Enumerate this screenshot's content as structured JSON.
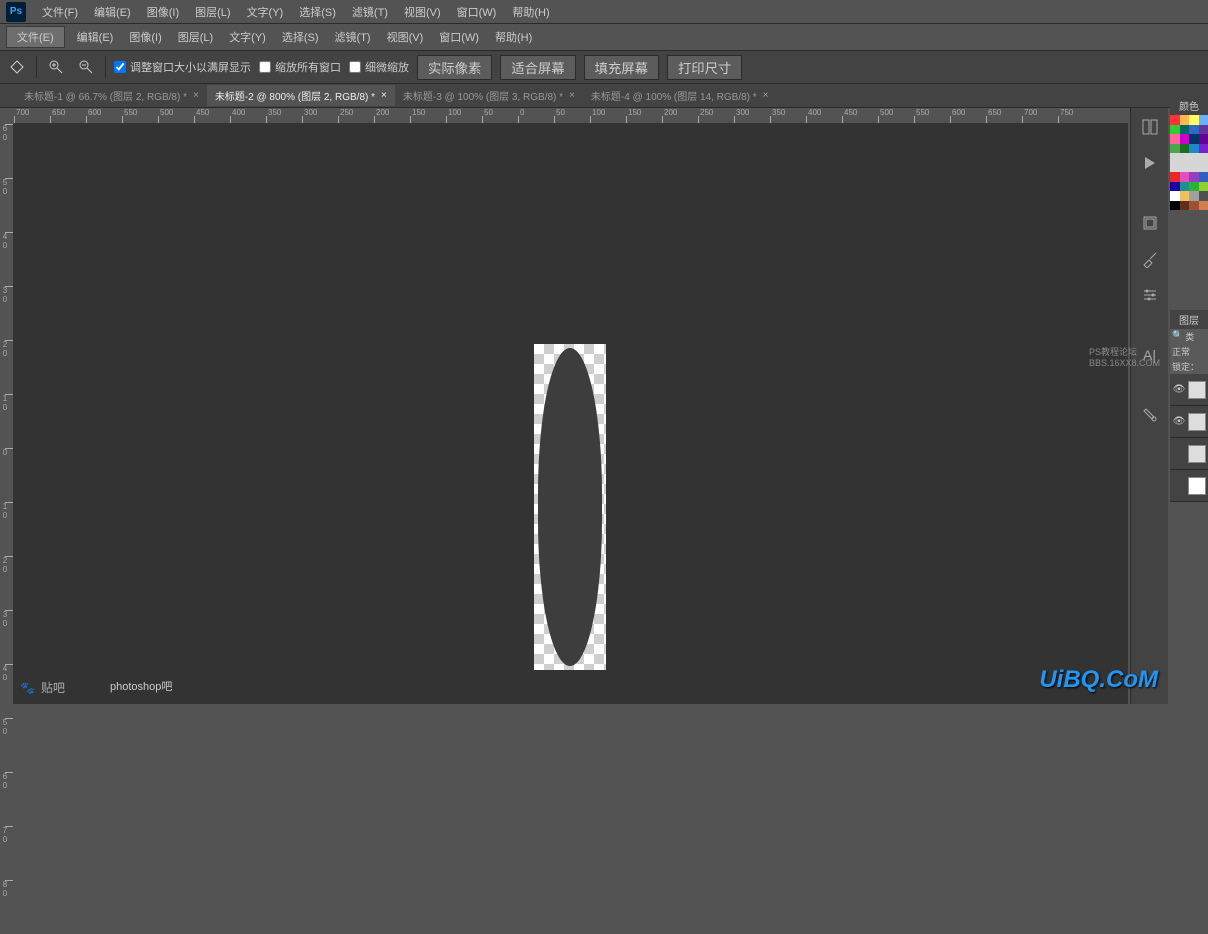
{
  "menubar": {
    "logo": "Ps",
    "items": [
      "文件(F)",
      "编辑(E)",
      "图像(I)",
      "图层(L)",
      "文字(Y)",
      "选择(S)",
      "滤镜(T)",
      "视图(V)",
      "窗口(W)",
      "帮助(H)"
    ]
  },
  "menubar2": {
    "fileitem": "文件(E)",
    "items": [
      "编辑(E)",
      "图像(I)",
      "图层(L)",
      "文字(Y)",
      "选择(S)",
      "滤镜(T)",
      "视图(V)",
      "窗口(W)",
      "帮助(H)"
    ]
  },
  "optbar": {
    "resize_windows": "调整窗口大小以满屏显示",
    "zoom_all": "缩放所有窗口",
    "scrubby": "细微缩放",
    "actual_pixels": "实际像素",
    "fit_screen": "适合屏幕",
    "fill_screen": "填充屏幕",
    "print_size": "打印尺寸"
  },
  "tabs": [
    {
      "label": "未标题-1 @ 66.7% (图层 2, RGB/8) *",
      "active": false
    },
    {
      "label": "未标题-2 @ 800% (图层 2, RGB/8) *",
      "active": true
    },
    {
      "label": "未标题-3 @ 100% (图层 3, RGB/8) *",
      "active": false
    },
    {
      "label": "未标题-4 @ 100% (图层 14, RGB/8) *",
      "active": false
    }
  ],
  "ruler_top": [
    "700",
    "650",
    "600",
    "550",
    "500",
    "450",
    "400",
    "350",
    "300",
    "250",
    "200",
    "150",
    "100",
    "50",
    "0",
    "50",
    "100",
    "150",
    "200",
    "250",
    "300",
    "350",
    "400",
    "450",
    "500",
    "550",
    "600",
    "650",
    "700",
    "750"
  ],
  "ruler_left": [
    "60",
    "50",
    "40",
    "30",
    "20",
    "10",
    "0",
    "10",
    "20",
    "30",
    "40",
    "50",
    "60",
    "70",
    "80"
  ],
  "panels": {
    "color_title": "颜色",
    "swatch_colors": [
      "#ff3333",
      "#ffb84d",
      "#ffff66",
      "#66b3ff",
      "#33cc33",
      "#006666",
      "#3366cc",
      "#663399",
      "#ff6699",
      "#cc00cc",
      "#003366",
      "#660099",
      "#4da64d",
      "#1b6e1b",
      "#1f87cc",
      "#7a1ece",
      "#d6d6d6",
      "#d6d6d6",
      "#d6d6d6",
      "#d6d6d6",
      "#d6d6d6",
      "#d6d6d6",
      "#d6d6d6",
      "#d6d6d6",
      "#e82727",
      "#e050c0",
      "#9040c0",
      "#3060c0",
      "#1e00a0",
      "#1e9090",
      "#30b030",
      "#90d030",
      "#ffffff",
      "#f0c060",
      "#a0a0a0",
      "#505050",
      "#000000",
      "#603018",
      "#a05030",
      "#d08050"
    ],
    "layers_title": "图层",
    "layers_kind": "类",
    "layers_mode": "正常",
    "layers_lock": "锁定："
  },
  "watermarks": {
    "baidu": "贴吧",
    "psba": "photoshop吧",
    "uibq": "UiBQ.CoM",
    "forum1": "PS教程论坛",
    "forum2": "BBS.16XX8.COM"
  }
}
